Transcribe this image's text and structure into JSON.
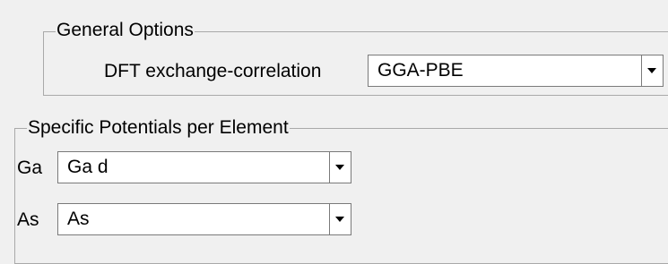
{
  "general_options": {
    "legend": "General Options",
    "dft_label": "DFT exchange-correlation",
    "dft_value": "GGA-PBE"
  },
  "specific_potentials": {
    "legend": "Specific Potentials per Element",
    "rows": [
      {
        "element": "Ga",
        "value": "Ga d"
      },
      {
        "element": "As",
        "value": "As"
      }
    ]
  },
  "icons": {
    "dropdown": "chevron-down-icon"
  }
}
